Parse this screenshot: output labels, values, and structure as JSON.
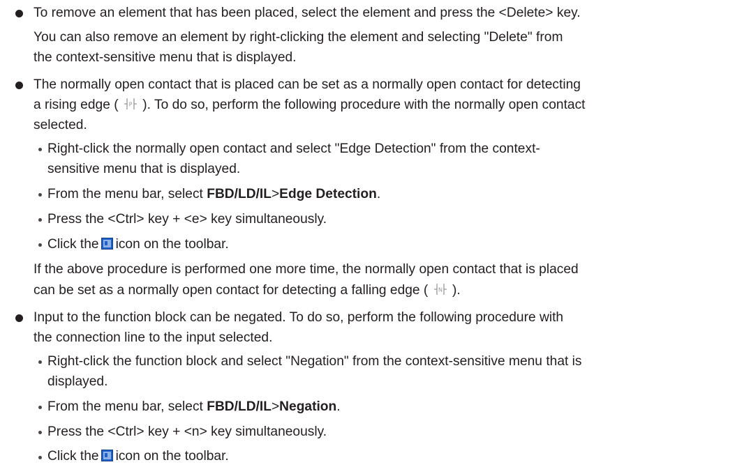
{
  "bullets": [
    {
      "lines": [
        "To remove an element that has been placed, select the element and press the <Delete> key.",
        "You can also remove an element by right-clicking the element and selecting \"Delete\" from",
        "the context-sensitive menu that is displayed."
      ]
    },
    {
      "line1": "The normally open contact that is placed can be set as a normally open contact for detecting",
      "line2_a": "a rising edge (",
      "line2_b": "). To do so, perform the following procedure with the normally open contact",
      "line3": "selected.",
      "sub_a1": "Right-click the normally open contact and select \"Edge Detection\" from the context-",
      "sub_a2": "sensitive menu that is displayed.",
      "sub_b_pre": "From the menu bar, select ",
      "sub_b_menu": "FBD/LD/IL",
      "sub_b_sep": ">",
      "sub_b_item": "Edge Detection",
      "sub_b_end": ".",
      "sub_c": "Press the <Ctrl> key + <e> key simultaneously.",
      "sub_d_pre": "Click the",
      "sub_d_post": "icon on the toolbar.",
      "after1": "If the above procedure is performed one more time, the normally open contact that is placed",
      "after2_a": "can be set as a normally open contact for detecting a falling edge (",
      "after2_b": ").",
      "rising_glyph": "P",
      "falling_glyph": "N"
    },
    {
      "line1": "Input to the function block can be negated. To do so, perform the following procedure with",
      "line2": "the connection line to the input selected.",
      "sub_a1": "Right-click the function block and select \"Negation\" from the context-sensitive menu that is",
      "sub_a2": "displayed.",
      "sub_b_pre": "From the menu bar, select ",
      "sub_b_menu": "FBD/LD/IL",
      "sub_b_sep": ">",
      "sub_b_item": "Negation",
      "sub_b_end": ".",
      "sub_c": "Press the <Ctrl> key + <n> key simultaneously.",
      "sub_d_pre": "Click the",
      "sub_d_post": "icon on the toolbar."
    }
  ],
  "icons": {
    "toolbar_icon_color": "#1f5fc8",
    "toolbar_icon_bg": "#8fb3e8"
  }
}
